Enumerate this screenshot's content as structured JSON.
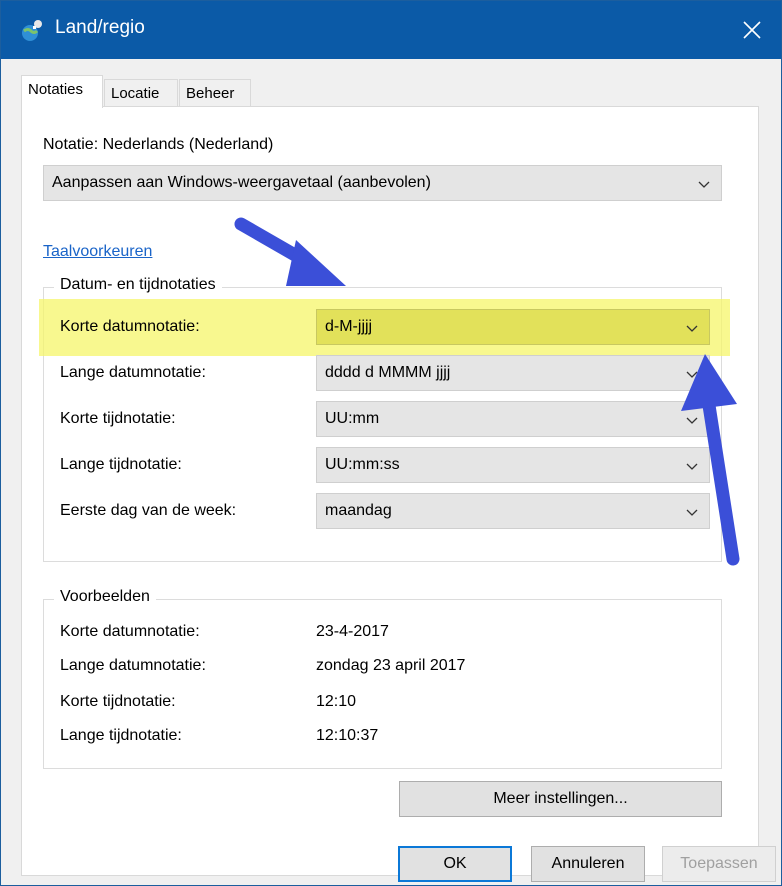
{
  "window": {
    "title": "Land/regio"
  },
  "tabs": [
    {
      "label": "Notaties"
    },
    {
      "label": "Locatie"
    },
    {
      "label": "Beheer"
    }
  ],
  "notatie": {
    "label": "Notatie: Nederlands (Nederland)",
    "select_value": "Aanpassen aan Windows-weergavetaal (aanbevolen)"
  },
  "link": "Taalvoorkeuren",
  "formats_group": {
    "title": "Datum- en tijdnotaties",
    "rows": [
      {
        "label": "Korte datumnotatie:",
        "value": "d-M-jjjj"
      },
      {
        "label": "Lange datumnotatie:",
        "value": "dddd d MMMM jjjj"
      },
      {
        "label": "Korte tijdnotatie:",
        "value": "UU:mm"
      },
      {
        "label": "Lange tijdnotatie:",
        "value": "UU:mm:ss"
      },
      {
        "label": "Eerste dag van de week:",
        "value": "maandag"
      }
    ]
  },
  "examples_group": {
    "title": "Voorbeelden",
    "rows": [
      {
        "label": "Korte datumnotatie:",
        "value": "23-4-2017"
      },
      {
        "label": "Lange datumnotatie:",
        "value": "zondag 23 april 2017"
      },
      {
        "label": "Korte tijdnotatie:",
        "value": "12:10"
      },
      {
        "label": "Lange tijdnotatie:",
        "value": "12:10:37"
      }
    ]
  },
  "buttons": {
    "more_settings": "Meer instellingen...",
    "ok": "OK",
    "cancel": "Annuleren",
    "apply": "Toepassen"
  },
  "colors": {
    "titlebar": "#0b5aa7",
    "highlight": "#f6f56a",
    "annotation_arrow": "#3b4fd8",
    "link": "#1a64c8"
  }
}
